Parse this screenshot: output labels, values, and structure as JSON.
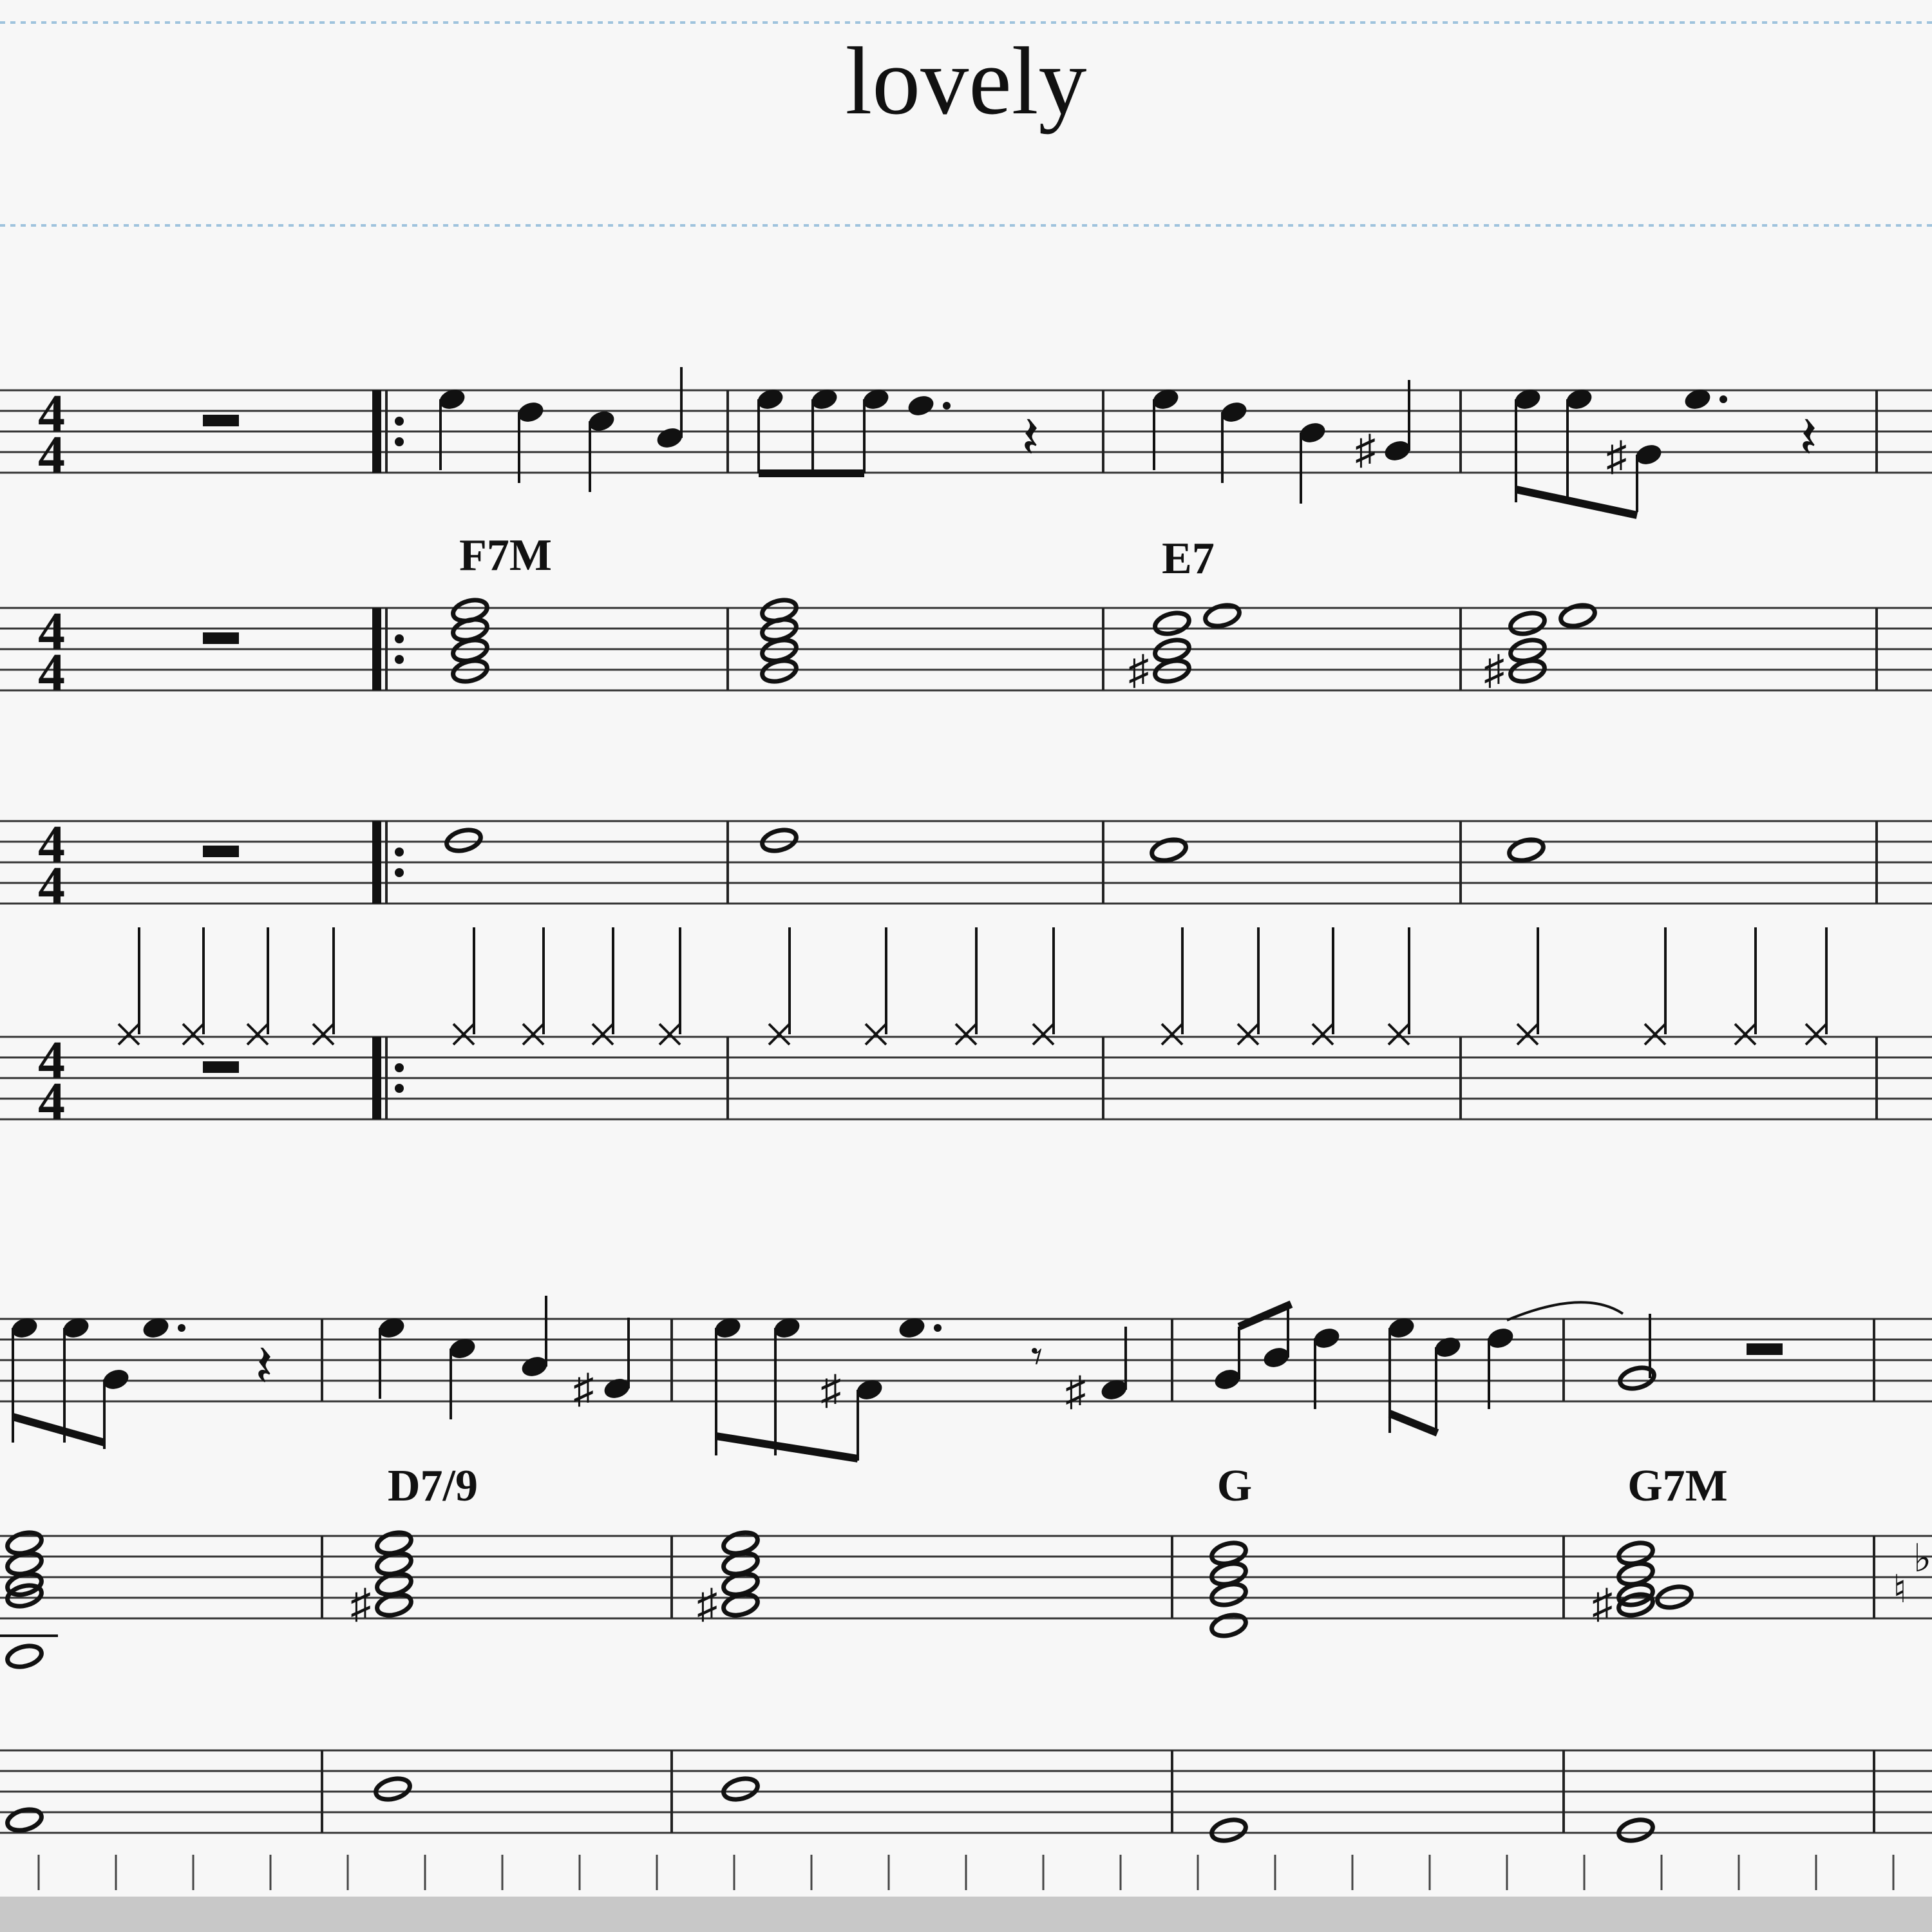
{
  "score": {
    "title": "lovely",
    "time_signature": {
      "numerator": "4",
      "denominator": "4"
    },
    "chord_symbols": [
      "F7M",
      "E7",
      "D7/9",
      "G",
      "G7M"
    ]
  },
  "colors": {
    "background": "#f7f7f7",
    "ink": "#111111",
    "page_guide": "#9fc3dd",
    "bottom_bar": "#c8c8c8"
  }
}
